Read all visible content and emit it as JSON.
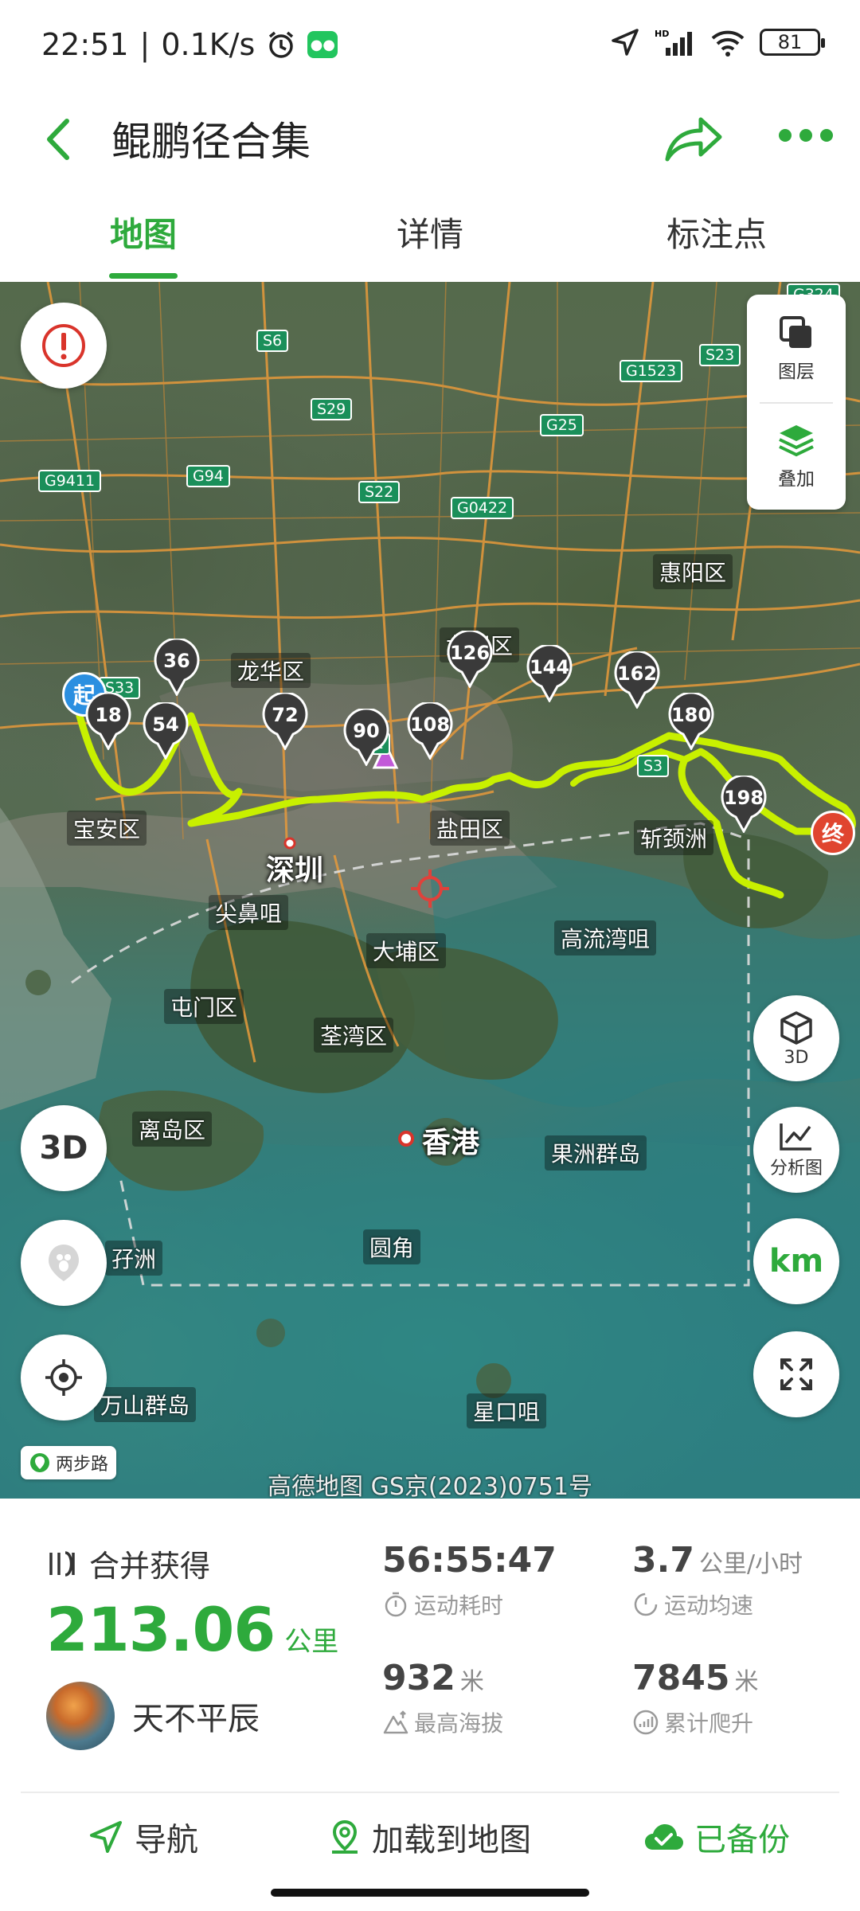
{
  "status_bar": {
    "time": "22:51",
    "net_speed": "0.1K/s",
    "battery": "81"
  },
  "app_bar": {
    "title": "鲲鹏径合集"
  },
  "tabs": [
    {
      "label": "地图",
      "active": true
    },
    {
      "label": "详情",
      "active": false
    },
    {
      "label": "标注点",
      "active": false
    }
  ],
  "map": {
    "layers_label": "图层",
    "overlay_label": "叠加",
    "btn_3d_label": "3D",
    "analysis_label": "分析图",
    "km_label": "km",
    "two_step_label": "两步路",
    "copyright": "高德地图 GS京(2023)0751号",
    "start_label": "起",
    "end_label": "终",
    "km_markers": [
      "18",
      "36",
      "54",
      "72",
      "90",
      "108",
      "126",
      "144",
      "162",
      "180",
      "198"
    ],
    "place_labels": {
      "huiyang": "惠阳区",
      "longgang": "龙岗区",
      "longhua": "龙华区",
      "baoan": "宝安区",
      "shenzhen": "深圳",
      "yantian": "盐田区",
      "jianbizui": "尖鼻咀",
      "qianjingzhou": "斩颈洲",
      "gaoliuwanzui": "高流湾咀",
      "tuenmun": "屯门区",
      "taipo": "大埔区",
      "tsuenwan": "荃湾区",
      "islands": "离岛区",
      "hongkong": "香港",
      "guozhou": "果洲群岛",
      "yuanjiao": "圆角",
      "zaizhou": "孖洲",
      "wanshan": "万山群岛",
      "xingkouzui": "星口咀"
    },
    "highways": [
      "S6",
      "S23",
      "G1523",
      "S29",
      "G25",
      "G94",
      "G9411",
      "S22",
      "G0422",
      "S33",
      "S2",
      "S3",
      "G324"
    ]
  },
  "stats": {
    "merge_label": "合并获得",
    "distance": "213.06",
    "distance_unit": "公里",
    "user_name": "天不平辰",
    "duration": "56:55:47",
    "duration_label": "运动耗时",
    "avg_speed": "3.7",
    "avg_speed_unit": "公里/小时",
    "avg_speed_label": "运动均速",
    "max_alt": "932",
    "max_alt_unit": "米",
    "max_alt_label": "最高海拔",
    "climb": "7845",
    "climb_unit": "米",
    "climb_label": "累计爬升"
  },
  "actions": {
    "navigate": "导航",
    "load_map": "加载到地图",
    "backup": "已备份"
  },
  "colors": {
    "accent": "#2eaa3c",
    "route": "#c8f000",
    "warning": "#d9342b"
  }
}
